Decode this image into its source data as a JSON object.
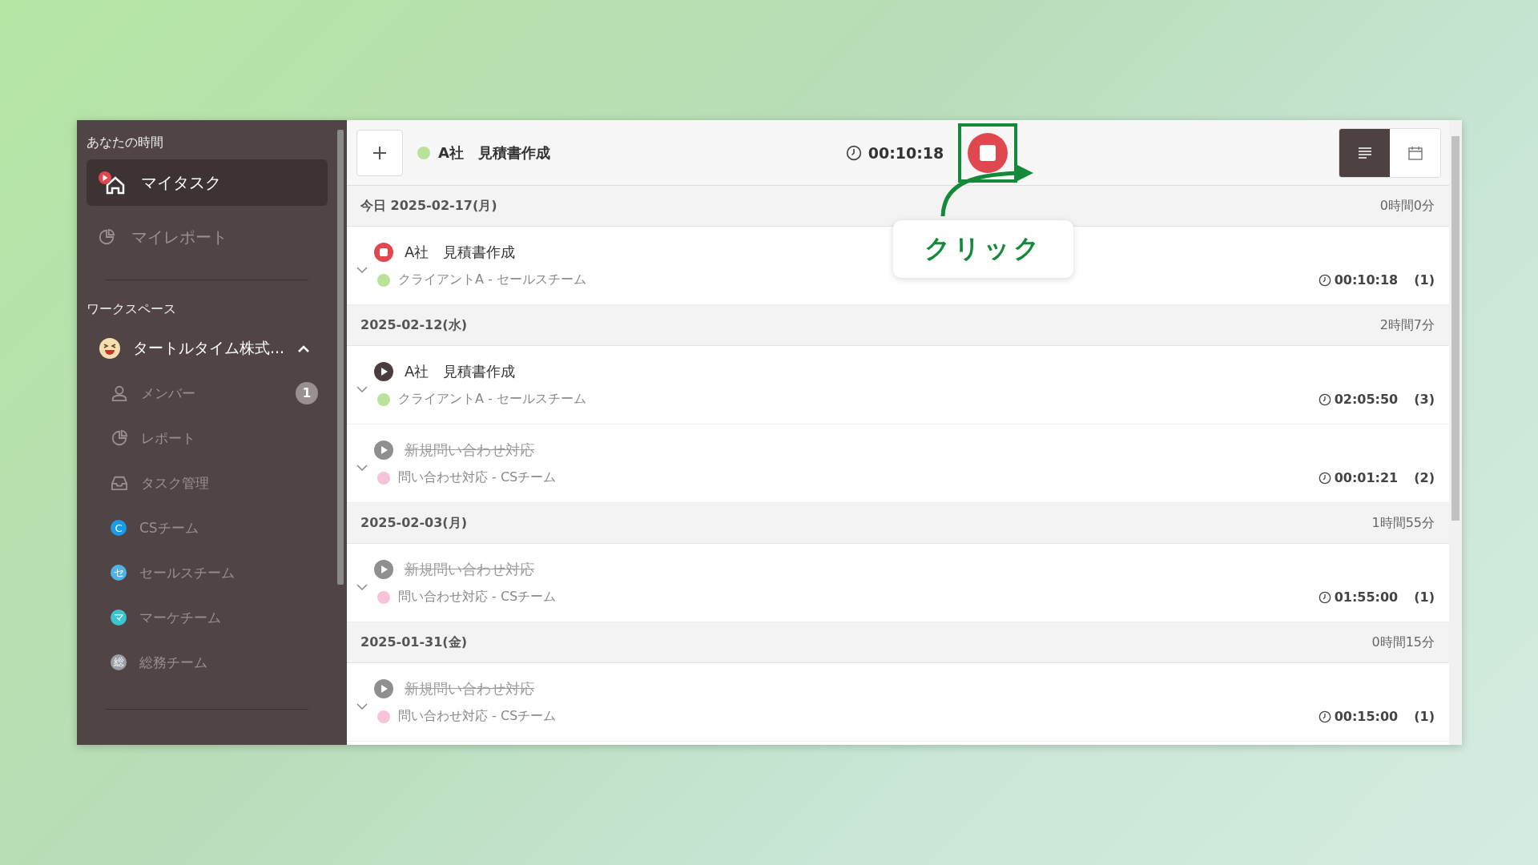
{
  "sidebar": {
    "section_title": "あなたの時間",
    "nav": [
      {
        "label": "マイタスク",
        "selected": true
      },
      {
        "label": "マイレポート",
        "selected": false
      }
    ],
    "workspace_title": "ワークスペース",
    "workspace": {
      "name": "タートルタイム株式...",
      "expanded": true,
      "items": [
        {
          "label": "メンバー",
          "kind": "member",
          "badge": "1"
        },
        {
          "label": "レポート",
          "kind": "report"
        },
        {
          "label": "タスク管理",
          "kind": "tasks"
        },
        {
          "label": "CSチーム",
          "kind": "team",
          "initial": "C",
          "color": "#1a9be6"
        },
        {
          "label": "セールスチーム",
          "kind": "team",
          "initial": "セ",
          "color": "#4fb3e8"
        },
        {
          "label": "マーケチーム",
          "kind": "team",
          "initial": "マ",
          "color": "#3cc4cf"
        },
        {
          "label": "総務チーム",
          "kind": "team",
          "initial": "総",
          "color": "#9aa0a6"
        }
      ]
    }
  },
  "header": {
    "title": "A社　見積書作成",
    "color": "#b9e29a",
    "timer": "00:10:18",
    "running": true,
    "views": [
      {
        "selected": true
      },
      {
        "selected": false
      }
    ]
  },
  "annotation": {
    "label": "クリック"
  },
  "days": [
    {
      "date": "今日 2025-02-17(月)",
      "total": "0時間0分",
      "tasks": [
        {
          "title": "A社　見積書作成",
          "kind": "running",
          "project": "クライアントA - セールスチーム",
          "color": "#b9e29a",
          "time": "00:10:18",
          "count": "(1)"
        }
      ]
    },
    {
      "date": "2025-02-12(水)",
      "total": "2時間7分",
      "tasks": [
        {
          "title": "A社　見積書作成",
          "kind": "paused",
          "project": "クライアントA - セールスチーム",
          "color": "#b9e29a",
          "time": "02:05:50",
          "count": "(3)"
        },
        {
          "title": "新規問い合わせ対応",
          "kind": "done",
          "project": "問い合わせ対応 - CSチーム",
          "color": "#f8c3d8",
          "time": "00:01:21",
          "count": "(2)"
        }
      ]
    },
    {
      "date": "2025-02-03(月)",
      "total": "1時間55分",
      "tasks": [
        {
          "title": "新規問い合わせ対応",
          "kind": "done",
          "project": "問い合わせ対応 - CSチーム",
          "color": "#f8c3d8",
          "time": "01:55:00",
          "count": "(1)"
        }
      ]
    },
    {
      "date": "2025-01-31(金)",
      "total": "0時間15分",
      "tasks": [
        {
          "title": "新規問い合わせ対応",
          "kind": "done",
          "project": "問い合わせ対応 - CSチーム",
          "color": "#f8c3d8",
          "time": "00:15:00",
          "count": "(1)"
        }
      ]
    }
  ]
}
